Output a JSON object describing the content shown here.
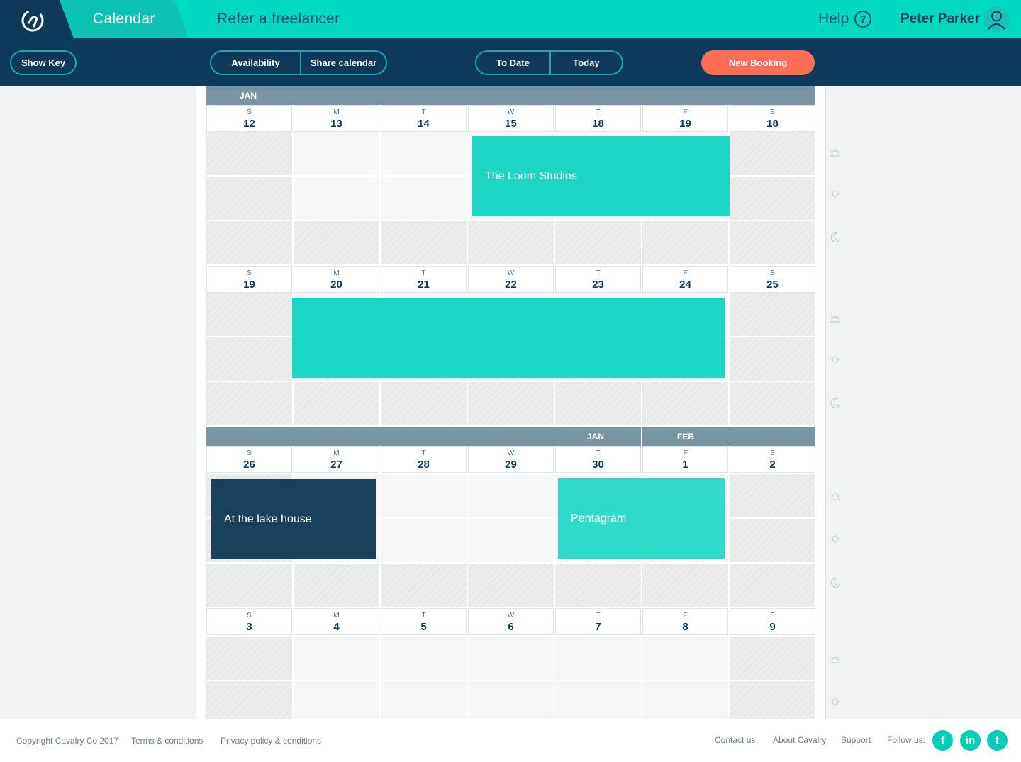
{
  "header": {
    "tab_calendar": "Calendar",
    "refer_link": "Refer a freelancer",
    "help_label": "Help",
    "help_glyph": "?",
    "user_name": "Peter Parker"
  },
  "toolbar": {
    "show_key": "Show Key",
    "availability": "Availability",
    "share_calendar": "Share calendar",
    "to_date": "To Date",
    "today": "Today",
    "new_booking": "New Booking"
  },
  "colors": {
    "navy": "#0d3a5b",
    "teal": "#00d9c0",
    "event_teal": "#1bd6c2",
    "event_navy": "#1a415c",
    "accent_orange": "#ff6d54",
    "month_bar": "#7a95a2"
  },
  "icons": {
    "slots": [
      "sunrise-icon",
      "sun-icon",
      "moon-icon"
    ]
  },
  "weeks": [
    {
      "month_labels": [
        "JAN"
      ],
      "days": [
        {
          "letter": "S",
          "num": "12"
        },
        {
          "letter": "M",
          "num": "13"
        },
        {
          "letter": "T",
          "num": "14"
        },
        {
          "letter": "W",
          "num": "15"
        },
        {
          "letter": "T",
          "num": "18"
        },
        {
          "letter": "F",
          "num": "19"
        },
        {
          "letter": "S",
          "num": "18"
        }
      ],
      "events": [
        {
          "title": "The Loom Studios"
        }
      ]
    },
    {
      "days": [
        {
          "letter": "S",
          "num": "19"
        },
        {
          "letter": "M",
          "num": "20"
        },
        {
          "letter": "T",
          "num": "21"
        },
        {
          "letter": "W",
          "num": "22"
        },
        {
          "letter": "T",
          "num": "23"
        },
        {
          "letter": "F",
          "num": "24"
        },
        {
          "letter": "S",
          "num": "25"
        }
      ],
      "events": [
        {
          "title": ""
        }
      ]
    },
    {
      "month_labels": [
        "JAN",
        "FEB"
      ],
      "days": [
        {
          "letter": "S",
          "num": "26"
        },
        {
          "letter": "M",
          "num": "27"
        },
        {
          "letter": "T",
          "num": "28"
        },
        {
          "letter": "W",
          "num": "29"
        },
        {
          "letter": "T",
          "num": "30"
        },
        {
          "letter": "F",
          "num": "1"
        },
        {
          "letter": "S",
          "num": "2"
        }
      ],
      "events": [
        {
          "title": "At the lake house"
        },
        {
          "title": "Pentagram"
        }
      ]
    },
    {
      "days": [
        {
          "letter": "S",
          "num": "3"
        },
        {
          "letter": "M",
          "num": "4"
        },
        {
          "letter": "T",
          "num": "5"
        },
        {
          "letter": "W",
          "num": "6"
        },
        {
          "letter": "T",
          "num": "7"
        },
        {
          "letter": "F",
          "num": "8"
        },
        {
          "letter": "S",
          "num": "9"
        }
      ],
      "events": []
    }
  ],
  "footer": {
    "copyright": "Copyright Cavalry Co 2017",
    "terms": "Terms & conditions",
    "privacy": "Privacy policy & conditions",
    "contact": "Contact us",
    "about": "About Cavalry",
    "support": "Support",
    "follow": "Follow us:",
    "facebook_glyph": "f",
    "linkedin_glyph": "in",
    "twitter_glyph": "t"
  }
}
